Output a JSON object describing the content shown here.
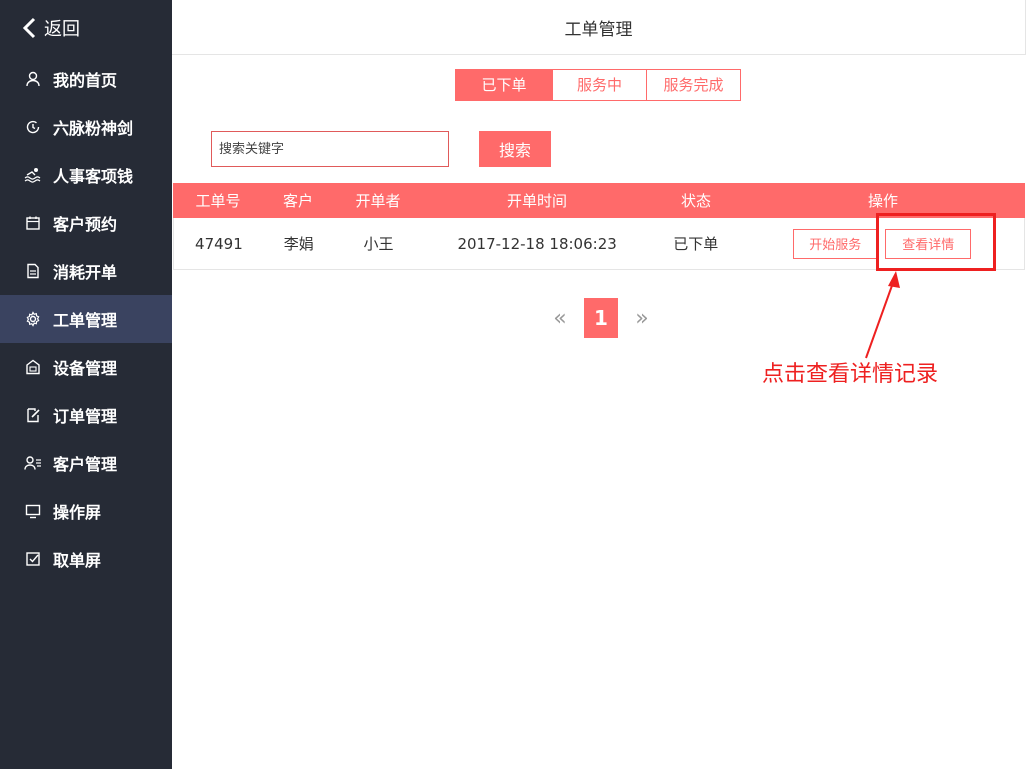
{
  "sidebar": {
    "back_label": "返回",
    "items": [
      {
        "label": "我的首页",
        "icon": "user-icon"
      },
      {
        "label": "六脉粉神剑",
        "icon": "refresh-icon"
      },
      {
        "label": "人事客项钱",
        "icon": "swim-icon"
      },
      {
        "label": "客户预约",
        "icon": "calendar-icon"
      },
      {
        "label": "消耗开单",
        "icon": "document-icon"
      },
      {
        "label": "工单管理",
        "icon": "gear-icon",
        "active": true
      },
      {
        "label": "设备管理",
        "icon": "device-icon"
      },
      {
        "label": "订单管理",
        "icon": "edit-icon"
      },
      {
        "label": "客户管理",
        "icon": "customers-icon"
      },
      {
        "label": "操作屏",
        "icon": "monitor-icon"
      },
      {
        "label": "取单屏",
        "icon": "checkbox-icon"
      }
    ]
  },
  "header": {
    "title": "工单管理"
  },
  "tabs": [
    {
      "label": "已下单",
      "active": true
    },
    {
      "label": "服务中"
    },
    {
      "label": "服务完成"
    }
  ],
  "search": {
    "placeholder": "搜索关键字",
    "button_label": "搜索"
  },
  "table": {
    "headers": [
      "工单号",
      "客户",
      "开单者",
      "开单时间",
      "状态",
      "操作"
    ],
    "rows": [
      {
        "id": "47491",
        "customer": "李娟",
        "creator": "小王",
        "time": "2017-12-18 18:06:23",
        "status": "已下单",
        "action_start": "开始服务",
        "action_detail": "查看详情"
      }
    ]
  },
  "pagination": {
    "prev": "«",
    "current": "1",
    "next": "»"
  },
  "annotation": {
    "text": "点击查看详情记录"
  },
  "colors": {
    "accent": "#ff6a6a",
    "sidebar_bg": "#262b36",
    "sidebar_active": "#3a4360",
    "annotation": "#ee2020"
  }
}
